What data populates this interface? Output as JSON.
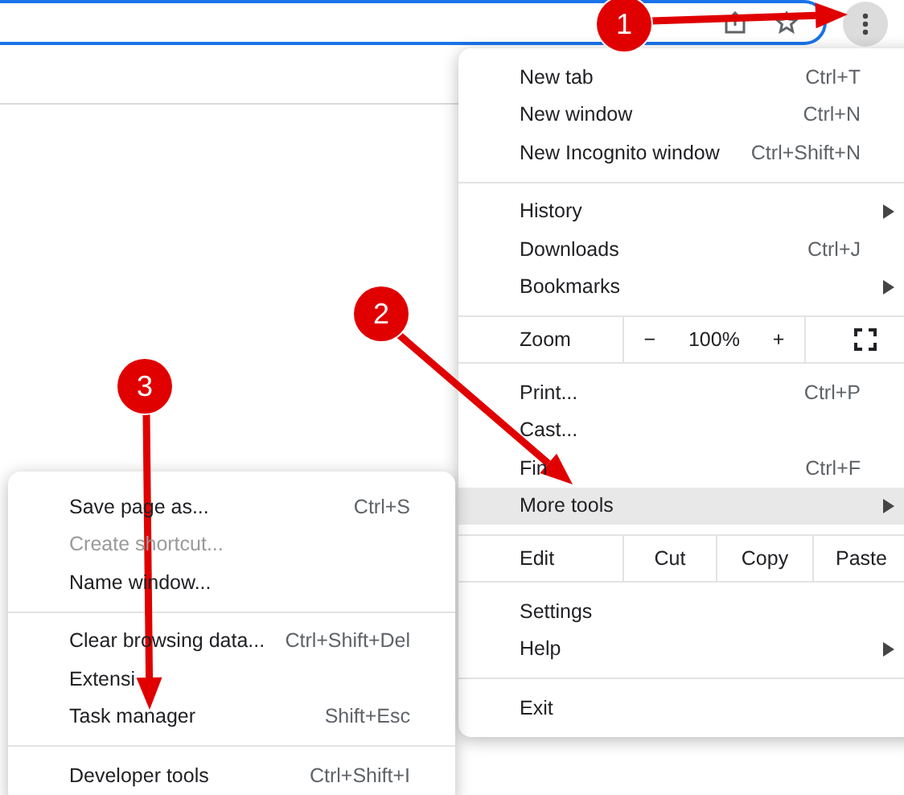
{
  "toolbar": {
    "menu_button": {
      "selected": true
    }
  },
  "main_menu": {
    "sections": [
      {
        "items": [
          {
            "kind": "item",
            "label": "New tab",
            "shortcut": "Ctrl+T",
            "submenu": false,
            "selected": false
          },
          {
            "kind": "item",
            "label": "New window",
            "shortcut": "Ctrl+N",
            "submenu": false,
            "selected": false
          },
          {
            "kind": "item",
            "label": "New Incognito window",
            "shortcut": "Ctrl+Shift+N",
            "submenu": false,
            "selected": false
          }
        ]
      },
      {
        "items": [
          {
            "kind": "item",
            "label": "History",
            "submenu": true,
            "selected": false
          },
          {
            "kind": "item",
            "label": "Downloads",
            "shortcut": "Ctrl+J",
            "submenu": false,
            "selected": false
          },
          {
            "kind": "item",
            "label": "Bookmarks",
            "submenu": true,
            "selected": false
          }
        ]
      },
      {
        "items": [
          {
            "kind": "zoom",
            "label": "Zoom",
            "minus": "−",
            "value": "100%",
            "plus": "+"
          }
        ]
      },
      {
        "items": [
          {
            "kind": "item",
            "label": "Print...",
            "shortcut": "Ctrl+P",
            "submenu": false,
            "selected": false
          },
          {
            "kind": "item",
            "label": "Cast...",
            "submenu": false,
            "selected": false
          },
          {
            "kind": "item",
            "label": "Fin",
            "shortcut": "Ctrl+F",
            "submenu": false,
            "selected": false
          },
          {
            "kind": "item",
            "label": "More tools",
            "submenu": true,
            "selected": true
          }
        ]
      },
      {
        "items": [
          {
            "kind": "edit",
            "label": "Edit",
            "buttons": [
              "Cut",
              "Copy",
              "Paste"
            ]
          }
        ]
      },
      {
        "items": [
          {
            "kind": "item",
            "label": "Settings",
            "submenu": false,
            "selected": false
          },
          {
            "kind": "item",
            "label": "Help",
            "submenu": true,
            "selected": false
          }
        ]
      },
      {
        "items": [
          {
            "kind": "item",
            "label": "Exit",
            "submenu": false,
            "selected": false
          }
        ]
      }
    ]
  },
  "more_tools_menu": {
    "sections": [
      {
        "items": [
          {
            "label": "Save page as...",
            "shortcut": "Ctrl+S",
            "disabled": false
          },
          {
            "label": "Create shortcut...",
            "disabled": true
          },
          {
            "label": "Name window...",
            "disabled": false
          }
        ]
      },
      {
        "items": [
          {
            "label": "Clear browsing data...",
            "shortcut": "Ctrl+Shift+Del",
            "disabled": false
          },
          {
            "label": "Extensi",
            "disabled": false
          },
          {
            "label": "Task manager",
            "shortcut": "Shift+Esc",
            "disabled": false
          }
        ]
      },
      {
        "items": [
          {
            "label": "Developer tools",
            "shortcut": "Ctrl+Shift+I",
            "disabled": false
          }
        ]
      }
    ]
  },
  "annotations": [
    {
      "number": "1"
    },
    {
      "number": "2"
    },
    {
      "number": "3"
    }
  ]
}
